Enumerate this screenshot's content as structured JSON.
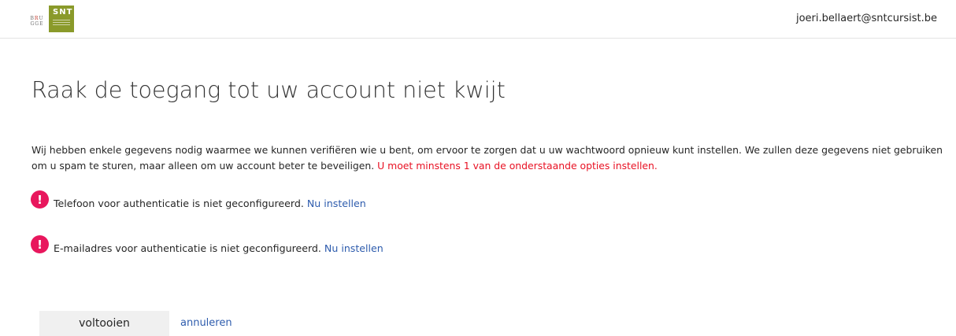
{
  "header": {
    "logo_text": "BRU GGE",
    "logo_badge": "SNT",
    "user_email": "joeri.bellaert@sntcursist.be"
  },
  "main": {
    "title": "Raak de toegang tot uw account niet kwijt",
    "intro_text": "Wij hebben enkele gegevens nodig waarmee we kunnen verifiëren wie u bent, om ervoor te zorgen dat u uw wachtwoord opnieuw kunt instellen. We zullen deze gegevens niet gebruiken om u spam te sturen, maar alleen om uw account beter te beveiligen.",
    "warning_text": "U moet minstens 1 van de onderstaande opties instellen.",
    "options": [
      {
        "text": "Telefoon voor authenticatie is niet geconfigureerd.",
        "link_label": "Nu instellen"
      },
      {
        "text": "E-mailadres voor authenticatie is niet geconfigureerd.",
        "link_label": "Nu instellen"
      }
    ],
    "finish_button": "voltooien",
    "cancel_link": "annuleren"
  },
  "colors": {
    "warning": "#e81123",
    "alert_icon": "#e8175d",
    "link": "#2e5cad",
    "logo_green": "#8a9a2a"
  },
  "icons": {
    "alert": "exclamation-circle-icon"
  }
}
